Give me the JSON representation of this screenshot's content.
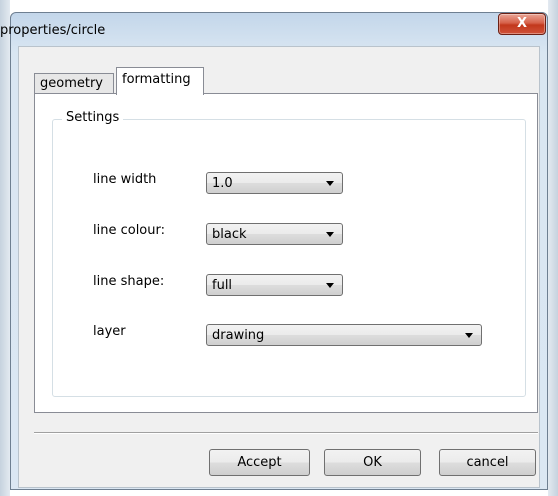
{
  "window": {
    "title": "properties/circle",
    "close_label": "X"
  },
  "tabs": [
    {
      "label": "geometry",
      "active": false
    },
    {
      "label": "formatting",
      "active": true
    }
  ],
  "settings": {
    "group_label": "Settings",
    "line_width": {
      "label": "line width",
      "value": "1.0"
    },
    "line_colour": {
      "label": "line colour:",
      "value": "black"
    },
    "line_shape": {
      "label": "line shape:",
      "value": "full"
    },
    "layer": {
      "label": "layer",
      "value": "drawing"
    }
  },
  "buttons": {
    "accept": "Accept",
    "ok": "OK",
    "cancel": "cancel"
  }
}
